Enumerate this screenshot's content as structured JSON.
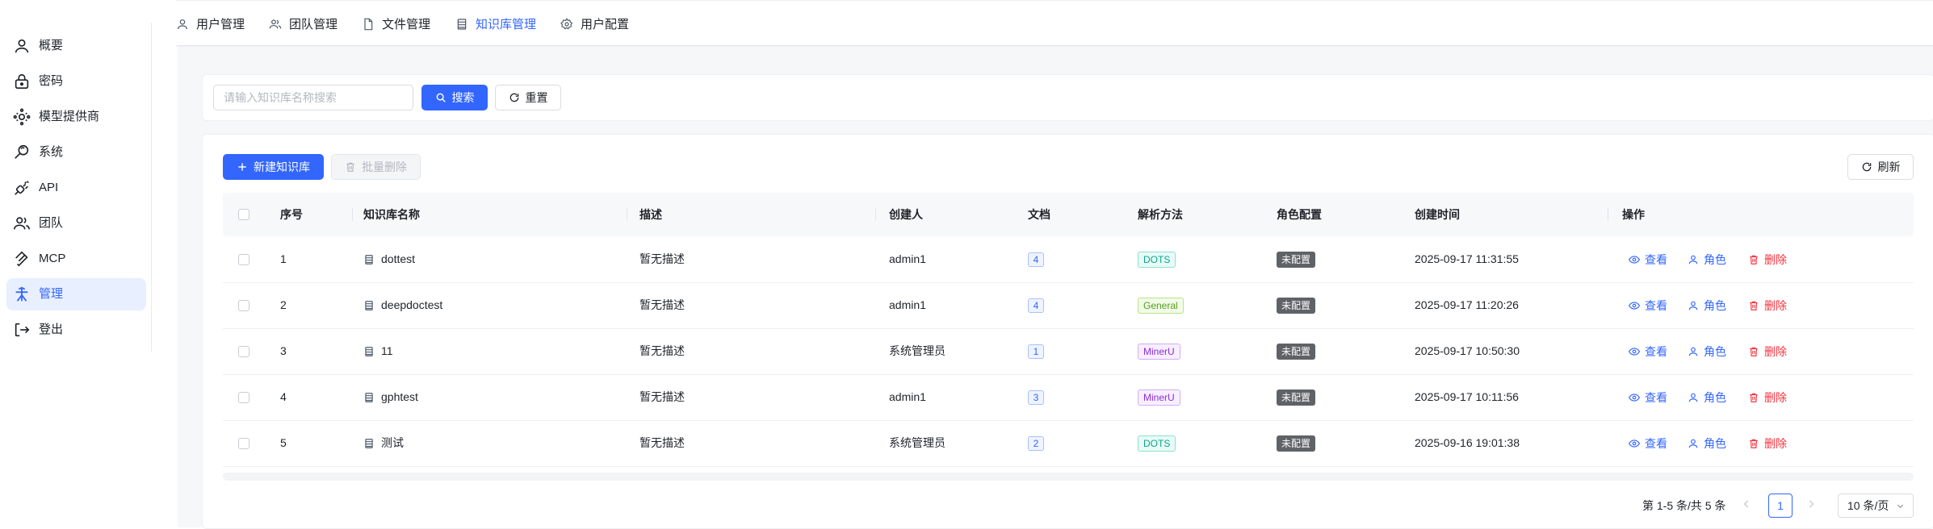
{
  "sidebar": {
    "items": [
      {
        "label": "概要",
        "icon": "user-icon"
      },
      {
        "label": "密码",
        "icon": "lock-icon"
      },
      {
        "label": "模型提供商",
        "icon": "model-provider-icon"
      },
      {
        "label": "系统",
        "icon": "system-search-icon"
      },
      {
        "label": "API",
        "icon": "plug-icon"
      },
      {
        "label": "团队",
        "icon": "team-icon"
      },
      {
        "label": "MCP",
        "icon": "mcp-icon"
      },
      {
        "label": "管理",
        "icon": "admin-icon",
        "active": true
      },
      {
        "label": "登出",
        "icon": "logout-icon"
      }
    ]
  },
  "tabs": [
    {
      "label": "用户管理",
      "icon": "user-icon"
    },
    {
      "label": "团队管理",
      "icon": "team-icon"
    },
    {
      "label": "文件管理",
      "icon": "file-icon"
    },
    {
      "label": "知识库管理",
      "icon": "database-icon",
      "active": true
    },
    {
      "label": "用户配置",
      "icon": "gear-icon"
    }
  ],
  "search": {
    "placeholder": "请输入知识库名称搜索",
    "value": "",
    "search_label": "搜索",
    "reset_label": "重置"
  },
  "toolbar": {
    "new_label": "新建知识库",
    "batch_delete_label": "批量删除",
    "refresh_label": "刷新"
  },
  "table": {
    "headers": [
      "序号",
      "知识库名称",
      "描述",
      "创建人",
      "文档",
      "解析方法",
      "角色配置",
      "创建时间",
      "操作"
    ],
    "rows": [
      {
        "index": "1",
        "name": "dottest",
        "description": "暂无描述",
        "creator": "admin1",
        "docs": "4",
        "method": "DOTS",
        "method_color": "cyan",
        "role": "未配置",
        "created": "2025-09-17 11:31:55"
      },
      {
        "index": "2",
        "name": "deepdoctest",
        "description": "暂无描述",
        "creator": "admin1",
        "docs": "4",
        "method": "General",
        "method_color": "green",
        "role": "未配置",
        "created": "2025-09-17 11:20:26"
      },
      {
        "index": "3",
        "name": "11",
        "description": "暂无描述",
        "creator": "系统管理员",
        "docs": "1",
        "method": "MinerU",
        "method_color": "purple",
        "role": "未配置",
        "created": "2025-09-17 10:50:30"
      },
      {
        "index": "4",
        "name": "gphtest",
        "description": "暂无描述",
        "creator": "admin1",
        "docs": "3",
        "method": "MinerU",
        "method_color": "purple",
        "role": "未配置",
        "created": "2025-09-17 10:11:56"
      },
      {
        "index": "5",
        "name": "测试",
        "description": "暂无描述",
        "creator": "系统管理员",
        "docs": "2",
        "method": "DOTS",
        "method_color": "cyan",
        "role": "未配置",
        "created": "2025-09-16 19:01:38"
      }
    ],
    "actions": {
      "view": "查看",
      "role": "角色",
      "delete": "删除"
    }
  },
  "pagination": {
    "total_text": "第 1-5 条/共 5 条",
    "current_page": "1",
    "page_size": "10 条/页"
  },
  "colors": {
    "accent": "#3366ff",
    "danger": "#f5333f",
    "active_bg": "#e8efff"
  }
}
